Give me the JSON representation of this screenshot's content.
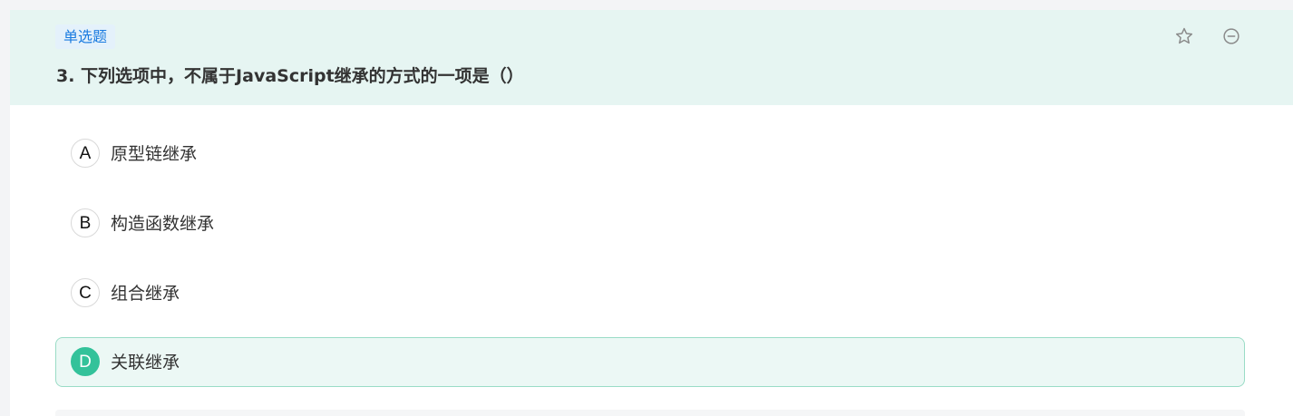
{
  "question": {
    "type_tag": "单选题",
    "title": "3. 下列选项中，不属于JavaScript继承的方式的一项是（）",
    "actions": {
      "favorite_icon": "star-outline-icon",
      "remove_icon": "minus-circle-icon"
    },
    "options": [
      {
        "letter": "A",
        "text": "原型链继承",
        "selected": false
      },
      {
        "letter": "B",
        "text": "构造函数继承",
        "selected": false
      },
      {
        "letter": "C",
        "text": "组合继承",
        "selected": false
      },
      {
        "letter": "D",
        "text": "关联继承",
        "selected": true
      }
    ]
  },
  "colors": {
    "header_bg": "#e6f5f2",
    "tag_text": "#1a7be0",
    "tag_bg": "#e4f1fb",
    "selected_accent": "#33c29a",
    "selected_bg": "#ecf8f5",
    "selected_border": "#9adcc6"
  }
}
